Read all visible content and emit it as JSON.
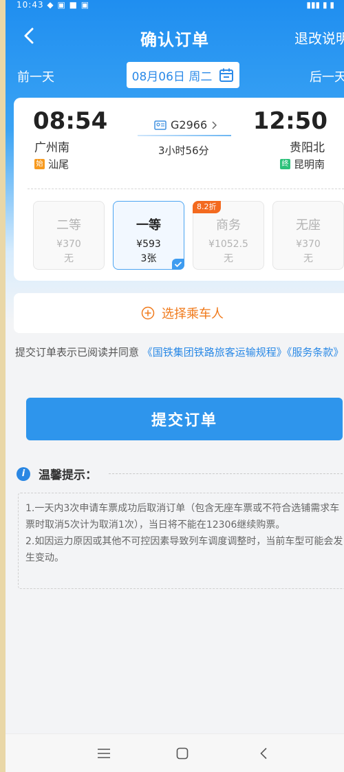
{
  "status_bar": {
    "left": "10:43 ◆ ▣ ■ ▣",
    "right": "▮▮▮ ▮ ▮"
  },
  "nav": {
    "title": "确认订单",
    "right": "退改说明"
  },
  "datebar": {
    "prev": "前一天",
    "date": "08月06日 周二",
    "next": "后一天"
  },
  "trip": {
    "dep_time": "08:54",
    "arr_time": "12:50",
    "dep_station": "广州南",
    "arr_station": "贵阳北",
    "origin_tag": "始",
    "origin": "汕尾",
    "terminal_tag": "终",
    "terminal": "昆明南",
    "train_no": "G2966",
    "duration": "3小时56分"
  },
  "seats": [
    {
      "name": "二等",
      "price": "¥370",
      "avail": "无"
    },
    {
      "name": "一等",
      "price": "¥593",
      "avail": "3张"
    },
    {
      "name": "商务",
      "price": "¥1052.5",
      "avail": "无"
    },
    {
      "name": "无座",
      "price": "¥370",
      "avail": "无"
    }
  ],
  "discount": "8.2折",
  "passenger": {
    "label": "选择乘车人"
  },
  "agreement": {
    "prefix": "提交订单表示已阅读并同意",
    "link1": "《国铁集团铁路旅客运输规程》",
    "link2": "《服务条款》"
  },
  "submit": "提交订单",
  "tips": {
    "title": "温馨提示：",
    "line1": "1.一天内3次申请车票成功后取消订单（包含无座车票或不符合选铺需求车票时取消5次计为取消1次），当日将不能在12306继续购票。",
    "line2": "2.如因运力原因或其他不可控因素导致列车调度调整时，当前车型可能会发生变动。"
  },
  "colors": {
    "primary": "#2e95ec",
    "accent": "#f07a1b"
  }
}
